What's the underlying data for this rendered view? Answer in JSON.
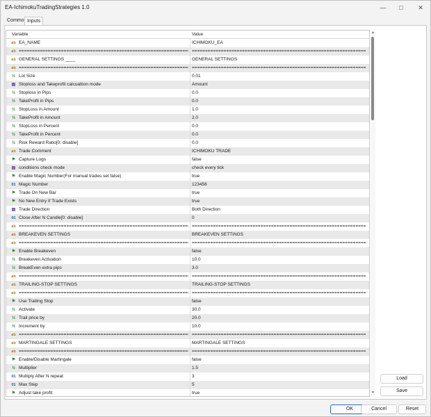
{
  "window": {
    "title": "EA-IchimokuTradingStrategies 1.0",
    "minimize_icon": "minimize-icon",
    "maximize_icon": "maximize-icon",
    "close_icon": "close-icon"
  },
  "tabs": [
    {
      "label": "Common"
    },
    {
      "label": "Inputs"
    }
  ],
  "grid": {
    "col_variable": "Variable",
    "col_value": "Value",
    "rows": [
      {
        "icon": "ab",
        "type": "abc",
        "name": "EA_NAME",
        "value": "ICHIMOKU_EA"
      },
      {
        "icon": "ab",
        "type": "abc",
        "name": "=================================================================================",
        "value": "================================================================================="
      },
      {
        "icon": "ab",
        "type": "abc",
        "name": "GENERAL SETTINGS  ____",
        "value": "GENERAL SETTINGS"
      },
      {
        "icon": "ab",
        "type": "abc",
        "name": "=================================================================================",
        "value": "================================================================================="
      },
      {
        "icon": "½",
        "type": "half",
        "name": "Lot Size",
        "value": "0.01"
      },
      {
        "icon": "▤",
        "type": "list",
        "name": "Stoploss and Takeprofit calcualtion mode",
        "value": "Amount"
      },
      {
        "icon": "½",
        "type": "half",
        "name": "Stoploss in Pips",
        "value": "0.0"
      },
      {
        "icon": "½",
        "type": "half",
        "name": "TakeProfit in Pips",
        "value": "0.0"
      },
      {
        "icon": "½",
        "type": "half",
        "name": "StopLoss in Amount",
        "value": "1.0"
      },
      {
        "icon": "½",
        "type": "half",
        "name": "TakeProfit in Amount",
        "value": "2.0"
      },
      {
        "icon": "½",
        "type": "half",
        "name": "StopLoss in Percent",
        "value": "0.0"
      },
      {
        "icon": "½",
        "type": "half",
        "name": "TakeProfit in Percent",
        "value": "0.0"
      },
      {
        "icon": "½",
        "type": "half",
        "name": "Risk Reward Ratio[0: disable]",
        "value": "0.0"
      },
      {
        "icon": "ab",
        "type": "abc",
        "name": "Trade Comment",
        "value": "ICHIMOKU TRADE"
      },
      {
        "icon": "⚑",
        "type": "flag",
        "name": "Capture Logs",
        "value": "false"
      },
      {
        "icon": "▤",
        "type": "list",
        "name": "conditions check mode",
        "value": "check every tick"
      },
      {
        "icon": "⚑",
        "type": "flag",
        "name": "Enable Magic Number(For manual trades set false)",
        "value": "true"
      },
      {
        "icon": "01",
        "type": "num",
        "name": "Magic Number",
        "value": "123456"
      },
      {
        "icon": "⚑",
        "type": "flag",
        "name": "Trade On New Bar",
        "value": "true"
      },
      {
        "icon": "⚑",
        "type": "flag",
        "name": "No New Entry If Trade Exists",
        "value": "true"
      },
      {
        "icon": "▤",
        "type": "list",
        "name": "Trade Direction",
        "value": "Both Direction"
      },
      {
        "icon": "01",
        "type": "num",
        "name": "Close After N Candle[0: disable]",
        "value": "0"
      },
      {
        "icon": "ab",
        "type": "abc",
        "name": "=================================================================================",
        "value": "================================================================================="
      },
      {
        "icon": "ab",
        "type": "abc",
        "name": "BREAKEVEN SETTINGS",
        "value": "BREAKEVEN SETTINGS"
      },
      {
        "icon": "ab",
        "type": "abc",
        "name": "=================================================================================",
        "value": "================================================================================="
      },
      {
        "icon": "⚑",
        "type": "flag",
        "name": "Enable Breakeven",
        "value": "false"
      },
      {
        "icon": "½",
        "type": "half",
        "name": "Breakeven Activation",
        "value": "10.0"
      },
      {
        "icon": "½",
        "type": "half",
        "name": "BreakEven extra pips",
        "value": "3.0"
      },
      {
        "icon": "ab",
        "type": "abc",
        "name": "=================================================================================",
        "value": "================================================================================="
      },
      {
        "icon": "ab",
        "type": "abc",
        "name": "TRAILING-STOP SETTINGS",
        "value": "TRAILING-STOP SETTINGS"
      },
      {
        "icon": "ab",
        "type": "abc",
        "name": "=================================================================================",
        "value": "================================================================================="
      },
      {
        "icon": "⚑",
        "type": "flag",
        "name": "Use Trailing Stop",
        "value": "false"
      },
      {
        "icon": "½",
        "type": "half",
        "name": "Activate",
        "value": "30.0"
      },
      {
        "icon": "½",
        "type": "half",
        "name": "Trail price by",
        "value": "20.0"
      },
      {
        "icon": "½",
        "type": "half",
        "name": "Increment by",
        "value": "10.0"
      },
      {
        "icon": "ab",
        "type": "abc",
        "name": "=================================================================================",
        "value": "================================================================================="
      },
      {
        "icon": "ab",
        "type": "abc",
        "name": "MARTINGALE SETTINGS",
        "value": "MARTINGALE SETTINGS"
      },
      {
        "icon": "ab",
        "type": "abc",
        "name": "=================================================================================",
        "value": "================================================================================="
      },
      {
        "icon": "⚑",
        "type": "flag",
        "name": "Enable/Disable Martingale",
        "value": "false"
      },
      {
        "icon": "½",
        "type": "half",
        "name": "Multiplier",
        "value": "1.5"
      },
      {
        "icon": "01",
        "type": "num",
        "name": "Multiply After N repeat",
        "value": "3"
      },
      {
        "icon": "01",
        "type": "num",
        "name": "Max Step",
        "value": "5"
      },
      {
        "icon": "⚑",
        "type": "flag",
        "name": "Adjust take profit",
        "value": "true"
      }
    ]
  },
  "side_buttons": {
    "load": "Load",
    "save": "Save"
  },
  "footer_buttons": {
    "ok": "OK",
    "cancel": "Cancel",
    "reset": "Reset"
  }
}
